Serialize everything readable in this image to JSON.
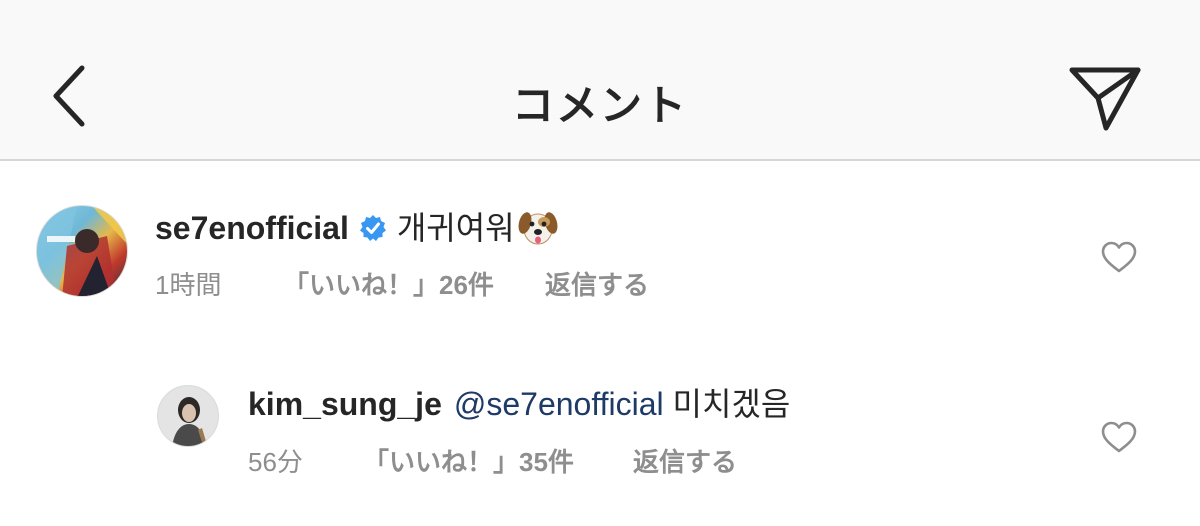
{
  "header": {
    "title": "コメント",
    "back_icon": "chevron-left-icon",
    "send_icon": "paper-plane-icon"
  },
  "comments": [
    {
      "username": "se7enofficial",
      "verified": true,
      "text": "개귀여워",
      "emoji": "dog-face",
      "time": "1時間",
      "likes": "「いいね！」26件",
      "reply": "返信する"
    },
    {
      "username": "kim_sung_je",
      "mention": "@se7enofficial",
      "text": "미치겠음",
      "time": "56分",
      "likes": "「いいね！」35件",
      "reply": "返信する"
    }
  ],
  "colors": {
    "header_bg": "#f9f9f9",
    "text": "#262626",
    "meta": "#8e8e8e",
    "mention": "#1e3a66",
    "verified": "#3897f0"
  }
}
